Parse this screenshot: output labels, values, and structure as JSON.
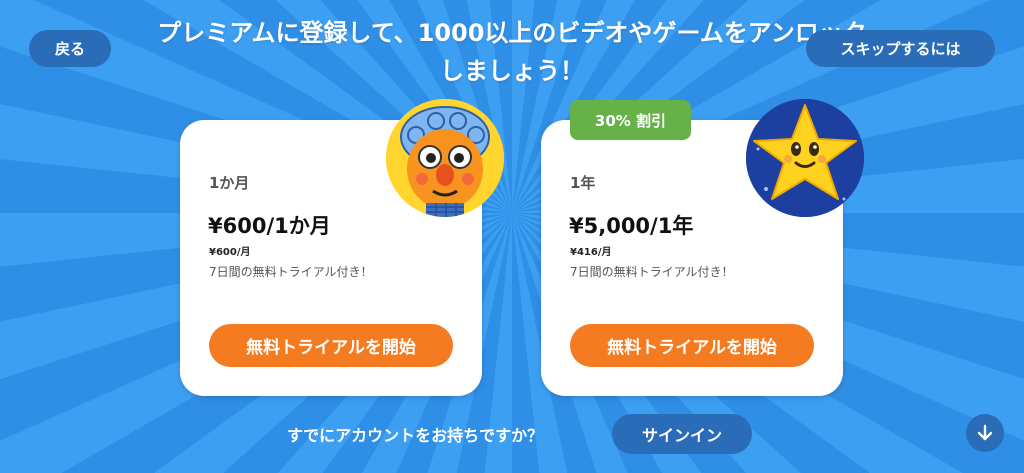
{
  "header": {
    "back_label": "戻る",
    "skip_label": "スキップするには",
    "headline": "プレミアムに登録して、1000以上のビデオやゲームをアンロックしましょう！"
  },
  "plans": [
    {
      "name": "1か月",
      "price": "¥600/1か月",
      "per_month": "¥600/月",
      "trial": "7日間の無料トライアル付き！",
      "cta": "無料トライアルを開始"
    },
    {
      "name": "1年",
      "price": "¥5,000/1年",
      "per_month": "¥416/月",
      "trial": "7日間の無料トライアル付き！",
      "cta": "無料トライアルを開始",
      "badge": "30% 割引"
    }
  ],
  "footer": {
    "question": "すでにアカウントをお持ちですか？",
    "signin_label": "サインイン"
  },
  "colors": {
    "background": "#3a9bf0",
    "pill_button": "#2a6cb8",
    "cta": "#f47b20",
    "badge": "#66b148"
  },
  "icons": {
    "down_button": "arrow-down-icon"
  }
}
